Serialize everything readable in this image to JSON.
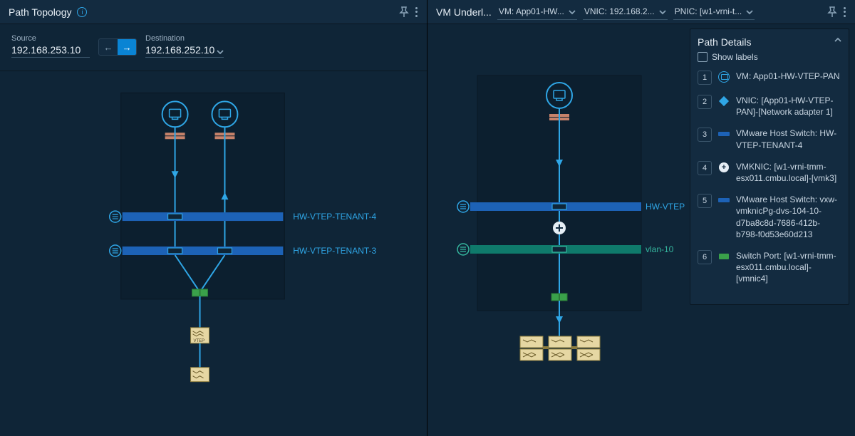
{
  "left": {
    "title": "Path Topology",
    "source_label": "Source",
    "source_value": "192.168.253.10",
    "dest_label": "Destination",
    "dest_value": "192.168.252.10",
    "bar1_label": "HW-VTEP-TENANT-4",
    "bar2_label": "HW-VTEP-TENANT-3",
    "vtep_label": "VTEP"
  },
  "right": {
    "title": "VM Underl...",
    "dd_vm": "VM: App01-HW...",
    "dd_vnic": "VNIC: 192.168.2...",
    "dd_pnic": "PNIC: [w1-vrni-t...",
    "bar1_label": "HW-VTEP",
    "bar2_label": "vlan-10"
  },
  "details": {
    "title": "Path Details",
    "show_labels": "Show labels",
    "steps": {
      "s1": {
        "num": "1",
        "text": "VM: App01-HW-VTEP-PAN"
      },
      "s2": {
        "num": "2",
        "text": "VNIC: [App01-HW-VTEP-PAN]-[Network adapter 1]"
      },
      "s3": {
        "num": "3",
        "text": "VMware Host Switch: HW-VTEP-TENANT-4"
      },
      "s4": {
        "num": "4",
        "text": "VMKNIC: [w1-vrni-tmm-esx011.cmbu.local]-[vmk3]"
      },
      "s5": {
        "num": "5",
        "text": "VMware Host Switch: vxw-vmknicPg-dvs-104-10-d7ba8c8d-7686-412b-b798-f0d53e60d213"
      },
      "s6": {
        "num": "6",
        "text": "Switch Port: [w1-vrni-tmm-esx011.cmbu.local]-[vmnic4]"
      }
    }
  }
}
